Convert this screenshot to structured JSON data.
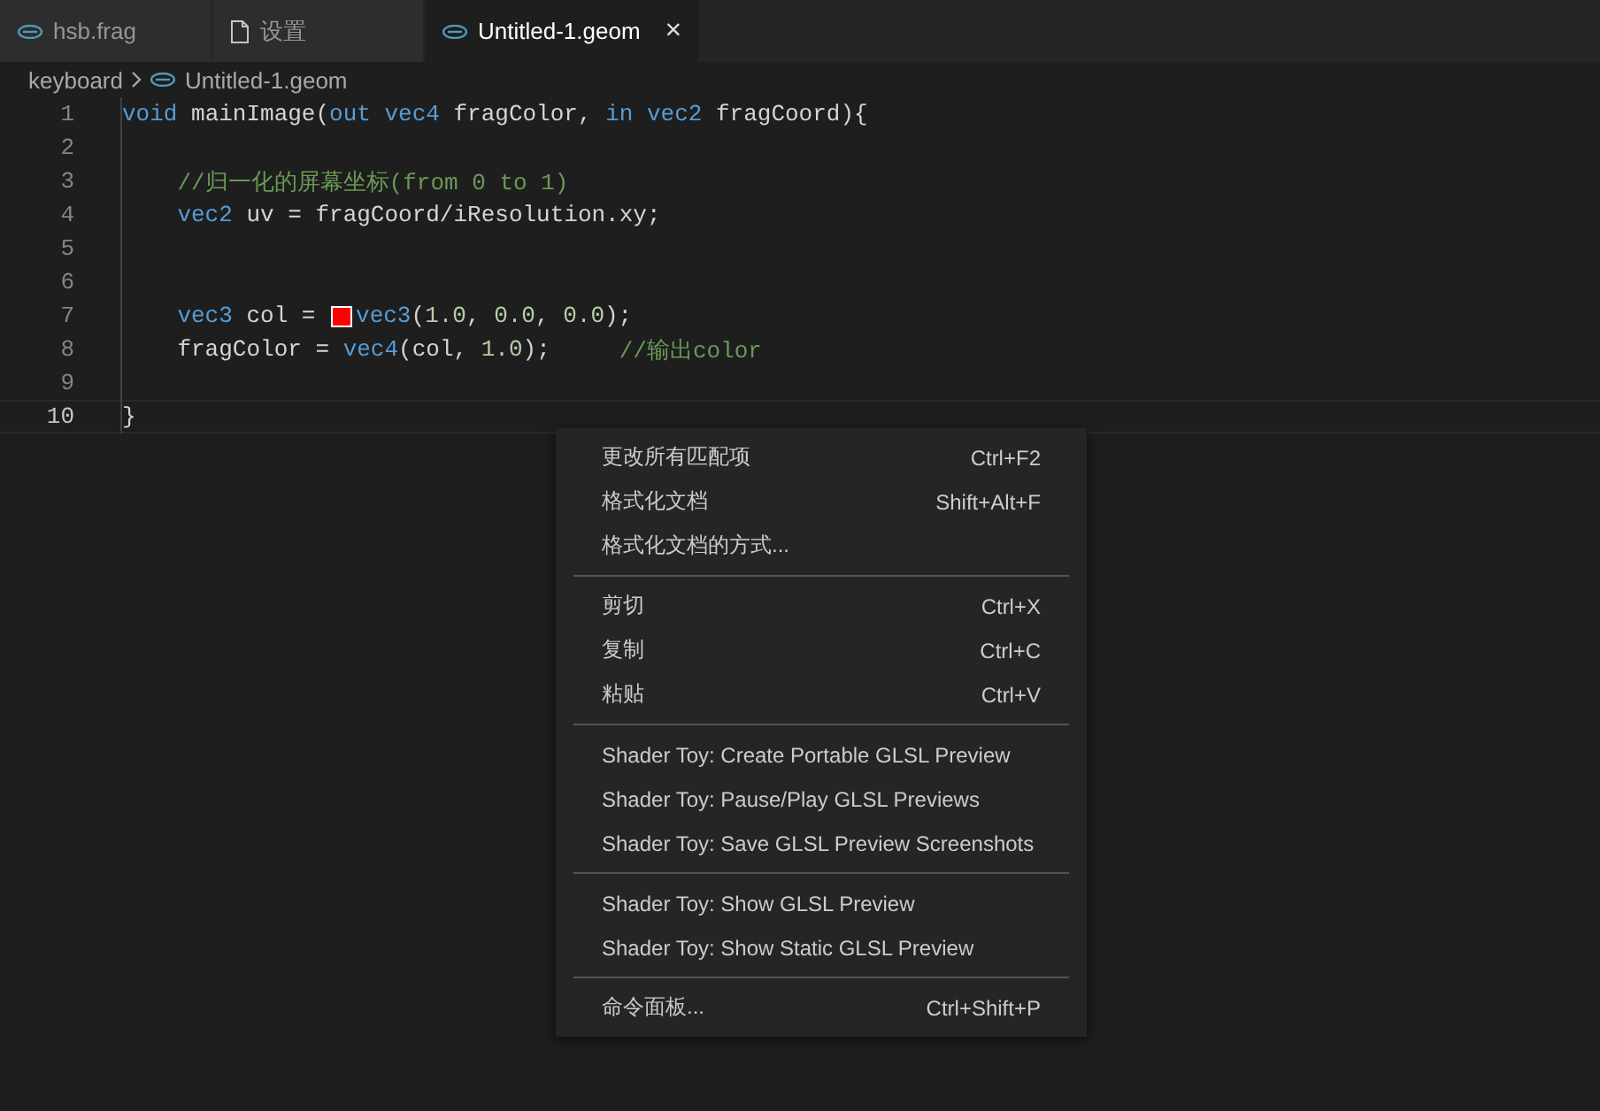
{
  "tabs": [
    {
      "label": "hsb.frag",
      "kind": "shader",
      "selected": false
    },
    {
      "label": "设置",
      "kind": "document",
      "selected": false
    },
    {
      "label": "Untitled-1.geom",
      "kind": "shader",
      "selected": true,
      "close_glyph": "×"
    }
  ],
  "breadcrumb": [
    {
      "label": "keyboard",
      "kind": "folder"
    },
    {
      "label": "Untitled-1.geom",
      "kind": "shader"
    }
  ],
  "editor": {
    "lines": [
      {
        "number": "1",
        "current": false,
        "tokens": [
          {
            "kind": "kw",
            "text": "void "
          },
          {
            "kind": "plain",
            "text": "mainImage("
          },
          {
            "kind": "kw",
            "text": "out vec4 "
          },
          {
            "kind": "plain",
            "text": "fragColor, "
          },
          {
            "kind": "kw",
            "text": "in vec2 "
          },
          {
            "kind": "plain",
            "text": "fragCoord){"
          }
        ]
      },
      {
        "number": "2",
        "current": false
      },
      {
        "number": "3",
        "current": false,
        "tokens": [
          {
            "kind": "comment",
            "text": "    //归一化的屏幕坐标(from 0 to 1)"
          }
        ]
      },
      {
        "number": "4",
        "current": false,
        "tokens": [
          {
            "kind": "kw",
            "text": "    vec2 "
          },
          {
            "kind": "plain",
            "text": "uv = fragCoord/iResolution.xy;"
          }
        ]
      },
      {
        "number": "5",
        "current": false
      },
      {
        "number": "6",
        "current": false
      },
      {
        "number": "7",
        "current": false,
        "tokens": [
          {
            "kind": "kw",
            "text": "    vec3 "
          },
          {
            "kind": "plain",
            "text": "col = "
          },
          {
            "kind": "swatch",
            "color": "#ff0000"
          },
          {
            "kind": "kw",
            "text": "vec3"
          },
          {
            "kind": "plain",
            "text": "("
          },
          {
            "kind": "num",
            "text": "1.0"
          },
          {
            "kind": "plain",
            "text": ", "
          },
          {
            "kind": "num",
            "text": "0.0"
          },
          {
            "kind": "plain",
            "text": ", "
          },
          {
            "kind": "num",
            "text": "0.0"
          },
          {
            "kind": "plain",
            "text": ");"
          }
        ]
      },
      {
        "number": "8",
        "current": false,
        "tokens": [
          {
            "kind": "plain",
            "text": "    fragColor = "
          },
          {
            "kind": "kw",
            "text": "vec4"
          },
          {
            "kind": "plain",
            "text": "(col, "
          },
          {
            "kind": "num",
            "text": "1.0"
          },
          {
            "kind": "plain",
            "text": ");     "
          },
          {
            "kind": "comment",
            "text": "//输出color"
          }
        ]
      },
      {
        "number": "9",
        "current": false
      },
      {
        "number": "10",
        "current": true,
        "tokens": [
          {
            "kind": "plain",
            "text": "}"
          }
        ]
      }
    ]
  },
  "context_menu": {
    "groups": [
      [
        {
          "label": "更改所有匹配项",
          "shortcut": "Ctrl+F2"
        },
        {
          "label": "格式化文档",
          "shortcut": "Shift+Alt+F"
        },
        {
          "label": "格式化文档的方式..."
        }
      ],
      [
        {
          "label": "剪切",
          "shortcut": "Ctrl+X"
        },
        {
          "label": "复制",
          "shortcut": "Ctrl+C"
        },
        {
          "label": "粘贴",
          "shortcut": "Ctrl+V"
        }
      ],
      [
        {
          "label": "Shader Toy: Create Portable GLSL Preview"
        },
        {
          "label": "Shader Toy: Pause/Play GLSL Previews"
        },
        {
          "label": "Shader Toy: Save GLSL Preview Screenshots"
        }
      ],
      [
        {
          "label": "Shader Toy: Show GLSL Preview"
        },
        {
          "label": "Shader Toy: Show Static GLSL Preview"
        }
      ],
      [
        {
          "label": "命令面板...",
          "shortcut": "Ctrl+Shift+P"
        }
      ]
    ]
  }
}
